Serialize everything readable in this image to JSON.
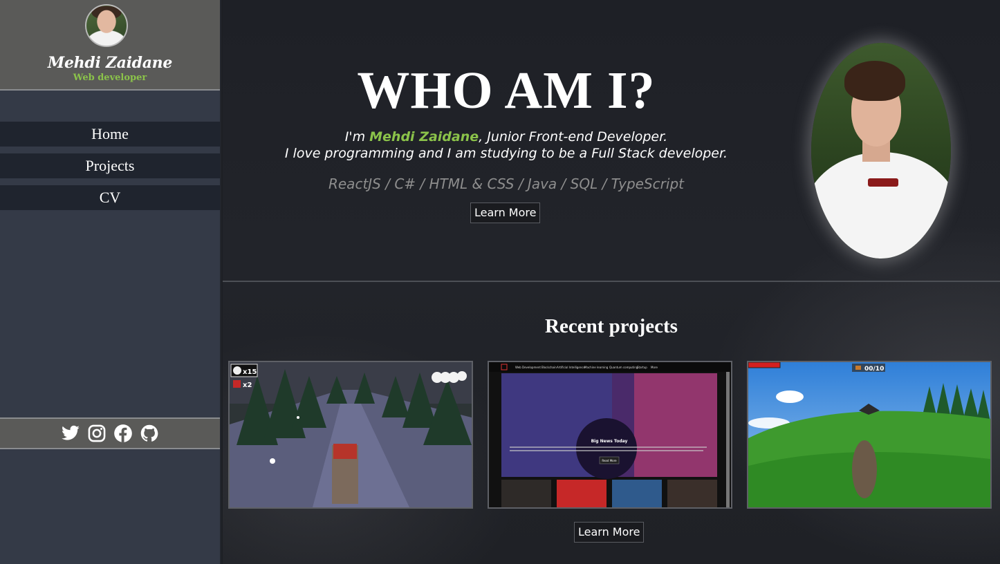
{
  "sidebar": {
    "name": "Mehdi Zaidane",
    "role": "Web developer",
    "nav": [
      {
        "label": "Home"
      },
      {
        "label": "Projects"
      },
      {
        "label": "CV"
      }
    ],
    "social": [
      "twitter-icon",
      "instagram-icon",
      "facebook-icon",
      "github-icon"
    ]
  },
  "hero": {
    "title": "WHO AM I?",
    "intro_prefix": "I'm ",
    "intro_name": "Mehdi Zaidane",
    "intro_suffix": ", Junior Front-end Developer.",
    "intro_line2": "I love programming and I am studying to be a Full Stack developer.",
    "skills": "ReactJS / C# / HTML & CSS / Java / SQL / TypeScript",
    "button": "Learn More"
  },
  "projects": {
    "title": "Recent projects",
    "button": "Learn More",
    "cards": [
      {
        "hud_snowballs": "x15",
        "hud_gifts": "x2"
      },
      {
        "nav_items": [
          "Web Development",
          "Blockchain",
          "Artificial Intelligence",
          "Machine learning",
          "Quantum computing",
          "Startup",
          "More"
        ],
        "headline": "Big News Today",
        "read_more": "Read More"
      },
      {
        "hud_counter": "00/10"
      }
    ]
  },
  "colors": {
    "accent": "#8bc34a",
    "sidebar_bg": "#343a47",
    "nav_bg": "#1f242e",
    "profile_bg": "#5a5a58"
  }
}
